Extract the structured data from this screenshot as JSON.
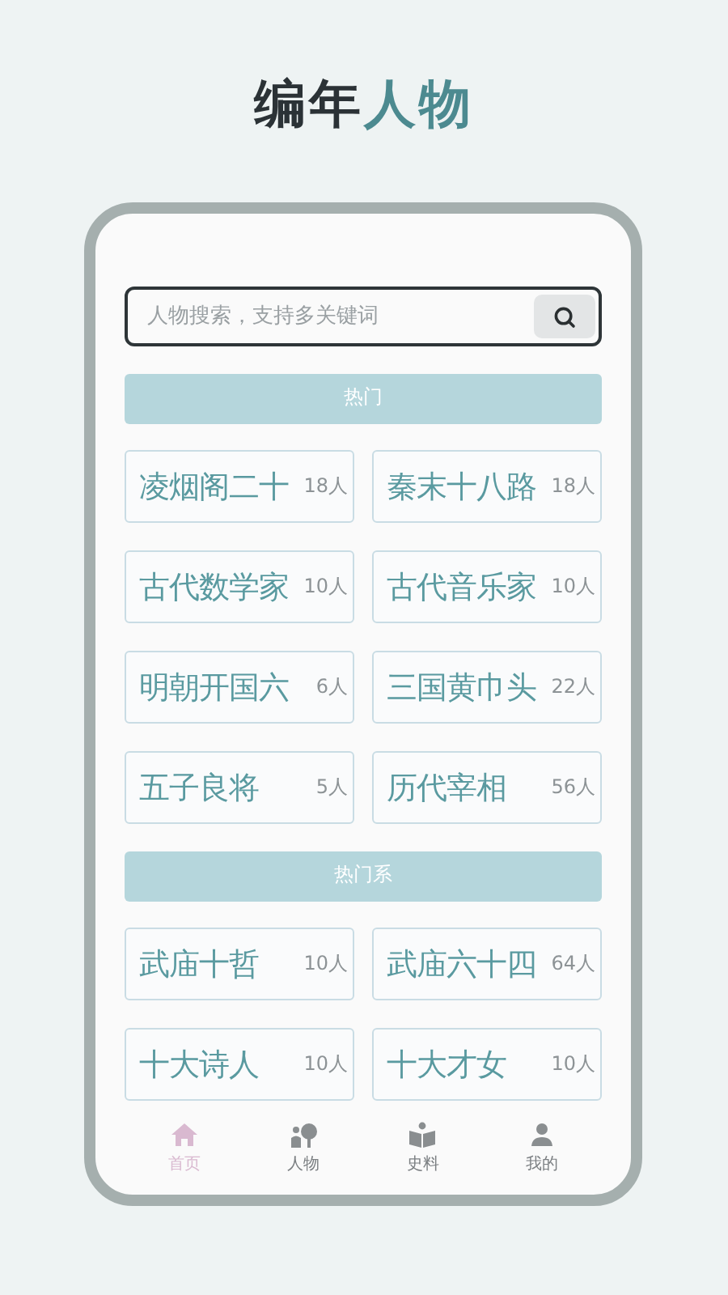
{
  "title": {
    "plain": "编年",
    "accent": "人物"
  },
  "search": {
    "placeholder": "人物搜索，支持多关键词"
  },
  "sections": [
    {
      "heading": "热门",
      "cards": [
        {
          "name": "凌烟阁二十",
          "count": "18人"
        },
        {
          "name": "秦末十八路",
          "count": "18人"
        },
        {
          "name": "古代数学家",
          "count": "10人"
        },
        {
          "name": "古代音乐家",
          "count": "10人"
        },
        {
          "name": "明朝开国六",
          "count": "6人"
        },
        {
          "name": "三国黄巾头",
          "count": "22人"
        },
        {
          "name": "五子良将",
          "count": "5人"
        },
        {
          "name": "历代宰相",
          "count": "56人"
        }
      ]
    },
    {
      "heading": "热门系",
      "cards": [
        {
          "name": "武庙十哲",
          "count": "10人"
        },
        {
          "name": "武庙六十四",
          "count": "64人"
        },
        {
          "name": "十大诗人",
          "count": "10人"
        },
        {
          "name": "十大才女",
          "count": "10人"
        }
      ]
    }
  ],
  "tabs": [
    {
      "label": "首页",
      "kind": "home",
      "selected": true
    },
    {
      "label": "人物",
      "kind": "people",
      "selected": false
    },
    {
      "label": "史料",
      "kind": "book",
      "selected": false
    },
    {
      "label": "我的",
      "kind": "user",
      "selected": false
    }
  ]
}
